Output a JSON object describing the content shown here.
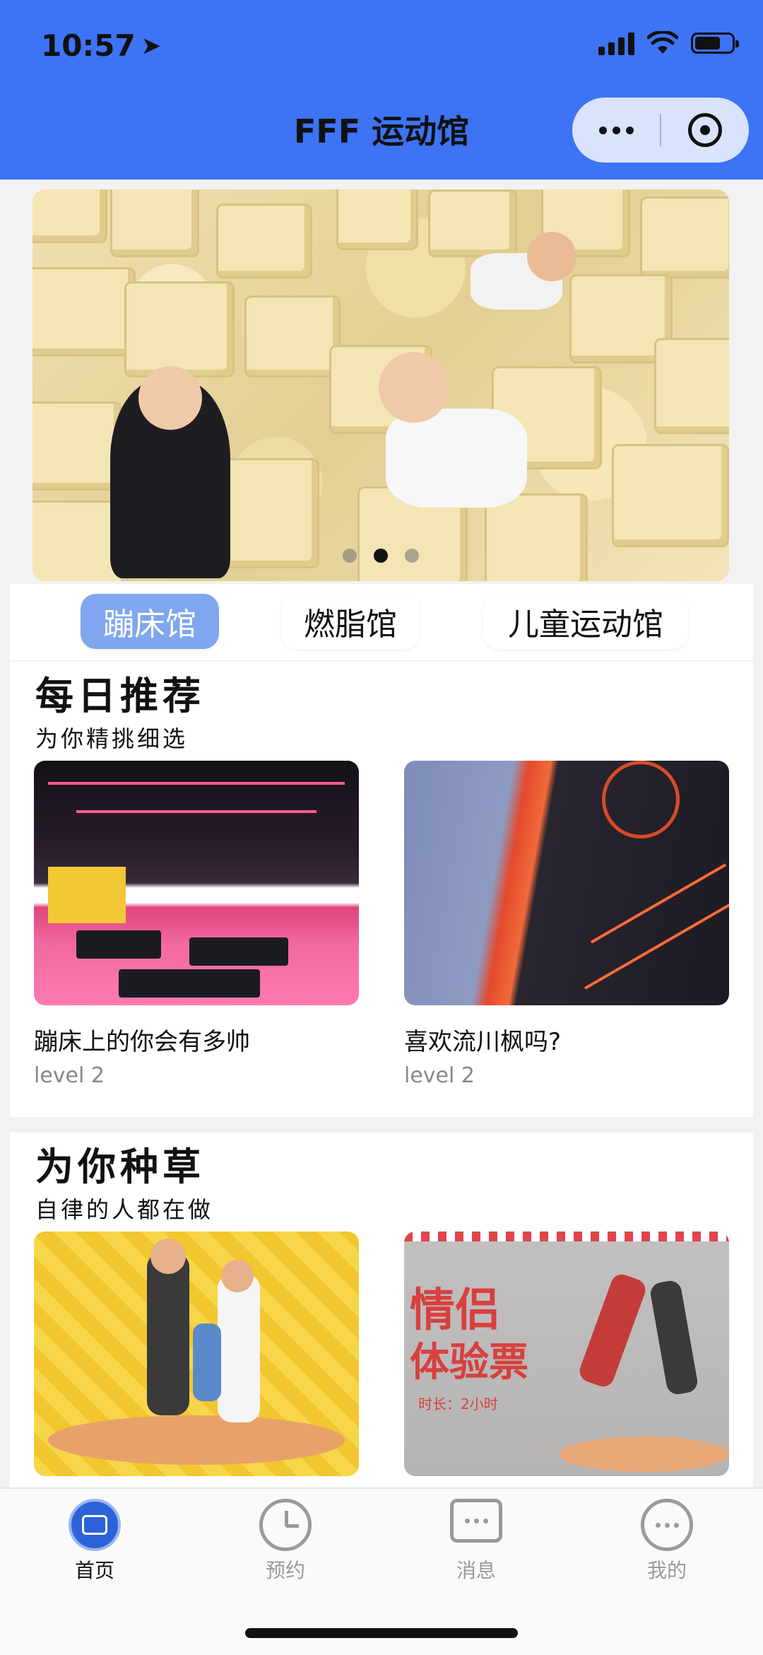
{
  "status_bar": {
    "time": "10:57"
  },
  "nav": {
    "title": "FFF 运动馆"
  },
  "banner": {
    "active_dot": 1,
    "dot_count": 3
  },
  "categories": [
    {
      "label": "蹦床馆",
      "active": true
    },
    {
      "label": "燃脂馆",
      "active": false
    },
    {
      "label": "儿童运动馆",
      "active": false
    }
  ],
  "daily": {
    "title": "每日推荐",
    "subtitle": "为你精挑细选",
    "cards": [
      {
        "title": "蹦床上的你会有多帅",
        "level": "level 2"
      },
      {
        "title": "喜欢流川枫吗?",
        "level": "level 2"
      }
    ]
  },
  "grass": {
    "title": "为你种草",
    "subtitle": "自律的人都在做",
    "couple_text_1": "情侣",
    "couple_text_2": "体验票",
    "couple_note": "时长：2小时"
  },
  "tabbar": [
    {
      "label": "首页",
      "icon": "home-icon",
      "active": true
    },
    {
      "label": "预约",
      "icon": "clock-icon",
      "active": false
    },
    {
      "label": "消息",
      "icon": "message-icon",
      "active": false
    },
    {
      "label": "我的",
      "icon": "profile-icon",
      "active": false
    }
  ]
}
